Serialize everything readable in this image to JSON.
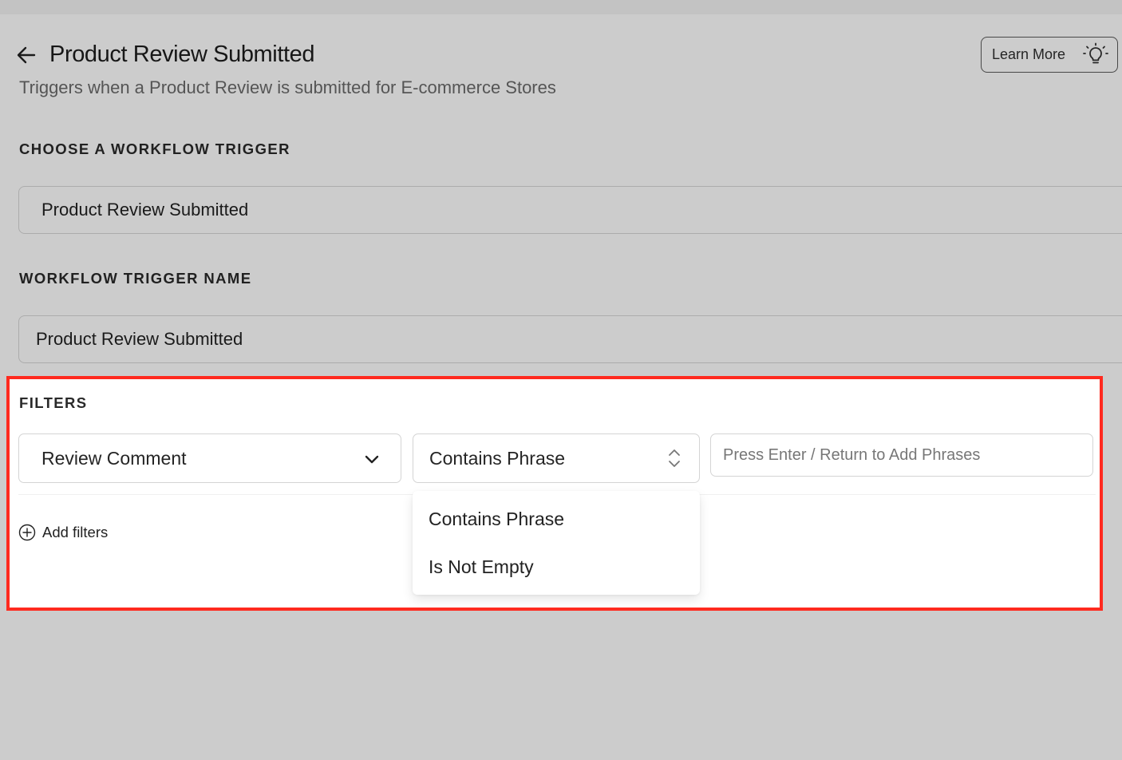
{
  "header": {
    "title": "Product Review Submitted",
    "subtitle": "Triggers when a Product Review is submitted for E-commerce Stores",
    "learn_more_label": "Learn More"
  },
  "trigger": {
    "section_label": "CHOOSE A WORKFLOW TRIGGER",
    "value": "Product Review Submitted"
  },
  "trigger_name": {
    "section_label": "WORKFLOW TRIGGER NAME",
    "value": "Product Review Submitted"
  },
  "filters": {
    "section_label": "FILTERS",
    "field_select_value": "Review Comment",
    "operator_select_value": "Contains Phrase",
    "phrase_placeholder": "Press Enter / Return to Add Phrases",
    "operator_options": [
      "Contains Phrase",
      "Is Not Empty"
    ],
    "add_filters_label": "Add filters"
  },
  "colors": {
    "highlight_outline": "#ff2a1f",
    "overlay": "rgba(0,0,0,0.2)"
  }
}
